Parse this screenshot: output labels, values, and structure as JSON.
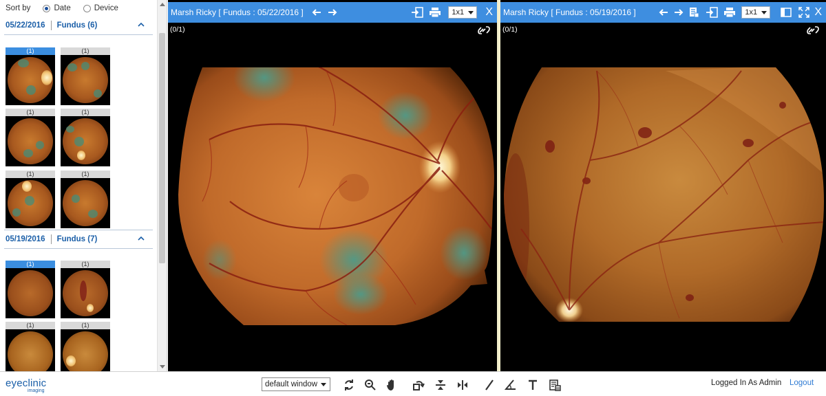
{
  "sort": {
    "label": "Sort by",
    "options": [
      {
        "label": "Date",
        "selected": true
      },
      {
        "label": "Device",
        "selected": false
      }
    ]
  },
  "groups": [
    {
      "date": "05/22/2016",
      "modality": "Fundus (6)",
      "thumbnails": [
        {
          "caption": "(1)",
          "selected": true
        },
        {
          "caption": "(1)",
          "selected": false
        },
        {
          "caption": "(1)",
          "selected": false
        },
        {
          "caption": "(1)",
          "selected": false
        },
        {
          "caption": "(1)",
          "selected": false
        },
        {
          "caption": "(1)",
          "selected": false
        }
      ]
    },
    {
      "date": "05/19/2016",
      "modality": "Fundus (7)",
      "thumbnails": [
        {
          "caption": "(1)",
          "selected": true
        },
        {
          "caption": "(1)",
          "selected": false
        },
        {
          "caption": "(1)",
          "selected": false
        },
        {
          "caption": "(1)",
          "selected": false
        }
      ]
    }
  ],
  "viewers": [
    {
      "title": "Marsh Ricky [ Fundus : 05/22/2016 ]",
      "layout": "1x1",
      "counter": "(0/1)",
      "close": "X"
    },
    {
      "title": "Marsh Ricky [ Fundus : 05/19/2016 ]",
      "layout": "1x1",
      "counter": "(0/1)",
      "close": "X"
    }
  ],
  "bottom": {
    "logo_text": "eyeclinic",
    "logo_sub": "imaging",
    "window_preset": "default window",
    "logged_in": "Logged In As Admin",
    "logout": "Logout"
  },
  "colors": {
    "accent": "#3e8ee0",
    "link": "#2f7bd3",
    "group_header": "#1b5fa8",
    "selected_thumb": "#3b8ee0"
  },
  "icons": {
    "toolbar": [
      "rotate-icon",
      "zoom-icon",
      "pan-hand-icon",
      "rotate-image-icon",
      "flip-vertical-icon",
      "flip-horizontal-icon",
      "line-tool-icon",
      "angle-tool-icon",
      "text-tool-icon",
      "report-icon"
    ]
  }
}
